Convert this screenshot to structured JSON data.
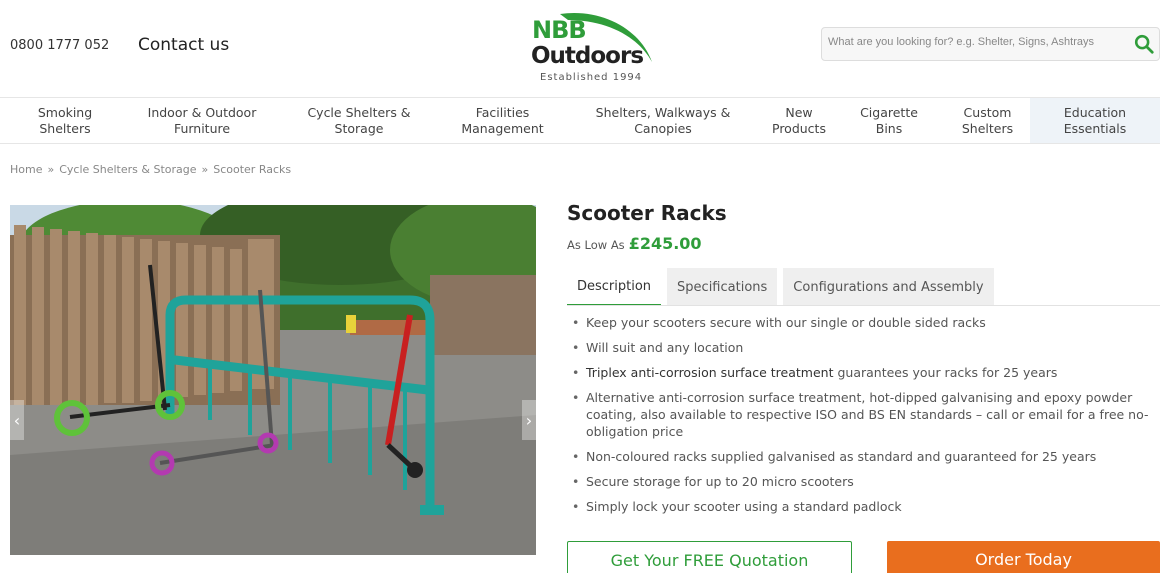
{
  "header": {
    "phone": "0800 1777 052",
    "contact_label": "Contact us",
    "logo": {
      "line1": "NBB",
      "line2": "Outdoors",
      "tagline": "Established 1994"
    },
    "search": {
      "placeholder": "What are you looking for? e.g. Shelter, Signs, Ashtrays",
      "icon": "search-icon"
    }
  },
  "nav": {
    "items": [
      {
        "label": "Smoking Shelters"
      },
      {
        "label": "Indoor & Outdoor Furniture"
      },
      {
        "label": "Cycle Shelters & Storage"
      },
      {
        "label": "Facilities Management"
      },
      {
        "label": "Shelters, Walkways & Canopies"
      },
      {
        "label": "New Products"
      },
      {
        "label": "Cigarette Bins"
      },
      {
        "label": "Custom Shelters"
      },
      {
        "label": "Education Essentials"
      }
    ]
  },
  "breadcrumb": {
    "items": [
      "Home",
      "Cycle Shelters & Storage",
      "Scooter Racks"
    ],
    "separator": "»"
  },
  "product": {
    "title": "Scooter Racks",
    "price_prefix": "As Low As",
    "price": "£245.00",
    "tabs": [
      "Description",
      "Specifications",
      "Configurations and Assembly"
    ],
    "active_tab": "Description",
    "bullets": [
      {
        "bold": "",
        "text": "Keep your scooters secure with our single or double sided racks"
      },
      {
        "bold": "",
        "text": "Will suit and any location"
      },
      {
        "bold": "Triplex anti-corrosion surface treatment",
        "text": " guarantees your racks for 25 years"
      },
      {
        "bold": "",
        "text": "Alternative anti-corrosion surface treatment, hot-dipped galvanising and epoxy powder coating, also available to respective ISO and BS EN standards – call or email for a free no-obligation price"
      },
      {
        "bold": "",
        "text": "Non-coloured racks supplied galvanised as standard and guaranteed for 25 years"
      },
      {
        "bold": "",
        "text": "Secure storage for up to 20 micro scooters"
      },
      {
        "bold": "",
        "text": "Simply lock your scooter using a standard padlock"
      }
    ],
    "quote_button": "Get Your FREE Quotation",
    "order_button": "Order Today"
  },
  "colors": {
    "brand_green": "#2f9d3a",
    "order_orange": "#e96e1e",
    "rack_teal": "#1fa39a"
  }
}
